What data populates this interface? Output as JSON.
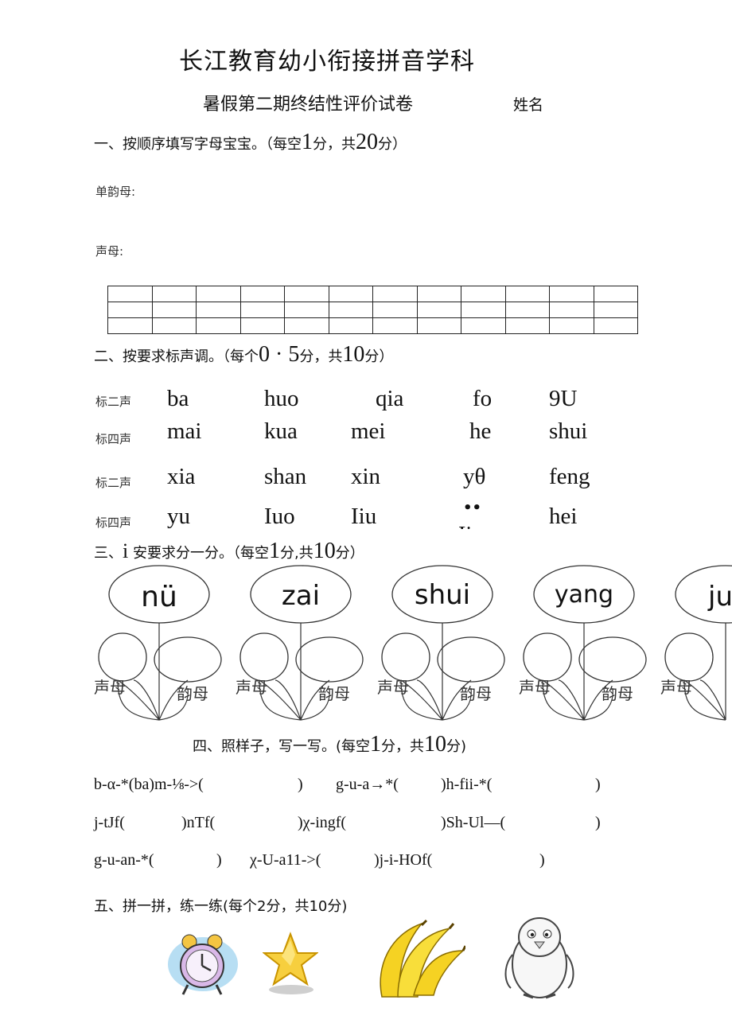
{
  "header": {
    "title": "长江教育幼小衔接拼音学科",
    "subtitle": "暑假第二期终结性评价试卷",
    "name_label": "姓名"
  },
  "section1": {
    "heading_pre": "一、按顺序填写字母宝宝。（每空",
    "n1": "1",
    "mid": "分，共",
    "n2": "20",
    "post": "分）",
    "label_vowels": "单韵母:",
    "label_initials": "声母:"
  },
  "section2": {
    "heading_pre": "二、按要求标声调。（每个",
    "n1": "0 · 5",
    "mid": "分，共",
    "n2": "10",
    "post": "分）",
    "rows": [
      {
        "label": "标二声",
        "items": [
          "ba",
          "huo",
          "qia",
          "fo",
          "9U"
        ]
      },
      {
        "label": "标四声",
        "items": [
          "mai",
          "kua",
          "mei",
          "he",
          "shui"
        ]
      },
      {
        "label": "标二声",
        "items": [
          "xia",
          "shan",
          "xin",
          "yθ",
          "feng"
        ]
      },
      {
        "label": "标四声",
        "items": [
          "yu",
          "Iuo",
          "Iiu",
          "••",
          "hei"
        ]
      }
    ]
  },
  "section3": {
    "heading_pre": "三、",
    "i": "i",
    "heading_mid": "安要求分一分。（每空",
    "n1": "1",
    "mid": "分,共",
    "n2": "10",
    "post": "分）",
    "flowers": [
      {
        "word": "nü",
        "left": "声母",
        "right": "韵母"
      },
      {
        "word": "zai",
        "left": "声母",
        "right": "韵母"
      },
      {
        "word": "shui",
        "left": "声母",
        "right": "韵母"
      },
      {
        "word": "yang",
        "left": "声母",
        "right": "韵母"
      },
      {
        "word": "ju",
        "left": "声母",
        "right": ""
      }
    ]
  },
  "section4": {
    "heading_pre": "四、照样子，写一写。(每空",
    "n1": "1",
    "mid": "分，共",
    "n2": "10",
    "post": "分)",
    "lines": [
      [
        "b-α-*(ba)m-⅛->(",
        ")",
        "g-u-a→*(",
        ")h-fii-*(",
        ")"
      ],
      [
        "j-tJf(",
        ")nTf(",
        ")χ-ingf(",
        ")Sh-Ul—(",
        ")"
      ],
      [
        "g-u-an-*(",
        ")",
        "χ-U-a11->(",
        ")j-i-HOf(",
        ")"
      ]
    ]
  },
  "section5": {
    "heading": "五、拼一拼，练一练(每个2分，共10分)",
    "pictures": [
      "alarm-clock",
      "star",
      "bananas",
      "penguin"
    ]
  }
}
